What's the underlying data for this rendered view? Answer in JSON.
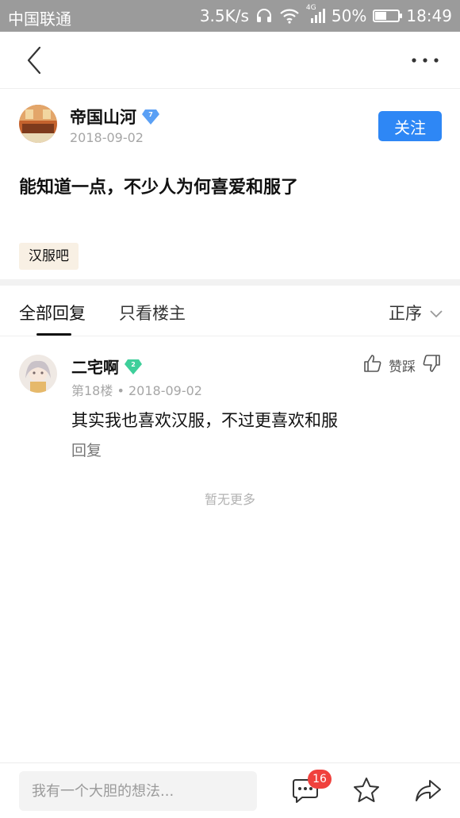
{
  "status_bar": {
    "carrier": "中国联通",
    "speed": "3.5K/s",
    "network": "4G",
    "battery": "50%",
    "battery_level": 0.5,
    "time": "18:49"
  },
  "post": {
    "author": "帝国山河",
    "level": "7",
    "date": "2018-09-02",
    "follow_label": "关注",
    "title": "能知道一点，不少人为何喜爱和服了",
    "tag": "汉服吧"
  },
  "tabs": {
    "all": "全部回复",
    "op_only": "只看楼主",
    "sort": "正序"
  },
  "comment": {
    "author": "二宅啊",
    "level": "2",
    "floor": "第18楼",
    "date": "2018-09-02",
    "like_label": "赞踩",
    "text": "其实我也喜欢汉服，不过更喜欢和服",
    "reply_label": "回复"
  },
  "no_more": "暂无更多",
  "bottom_bar": {
    "placeholder": "我有一个大胆的想法...",
    "comment_count": "16"
  },
  "colors": {
    "accent": "#2e87f5",
    "badge_red": "#f0413d",
    "level_blue": "#5aa0f5",
    "level_green": "#3ecf9a"
  }
}
